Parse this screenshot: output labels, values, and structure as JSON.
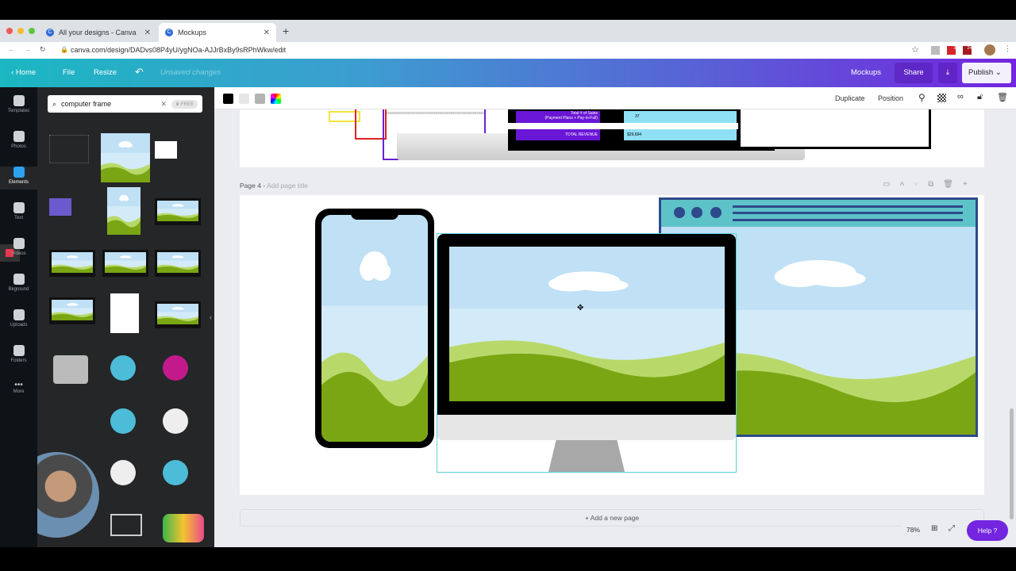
{
  "browser": {
    "tabs": [
      {
        "label": "All your designs - Canva"
      },
      {
        "label": "Mockups"
      }
    ],
    "url": "canva.com/design/DADvs08P4yU/ygNOa-AJJrBxBy9sRPhWkw/edit",
    "ext_badges": [
      "3",
      "24"
    ]
  },
  "header": {
    "home": "Home",
    "file": "File",
    "resize": "Resize",
    "status": "Unsaved changes",
    "design_name": "Mockups",
    "share": "Share",
    "publish": "Publish"
  },
  "rail": [
    {
      "label": "Templates"
    },
    {
      "label": "Photos"
    },
    {
      "label": "Elements"
    },
    {
      "label": "Text"
    },
    {
      "label": "Videos"
    },
    {
      "label": "Bkground"
    },
    {
      "label": "Uploads"
    },
    {
      "label": "Folders"
    },
    {
      "label": "More"
    }
  ],
  "panel": {
    "search_value": "computer frame",
    "free_badge": "FREE",
    "pro_badge": "$"
  },
  "toolbar": {
    "colors": [
      "#000000",
      "#e6e6e6",
      "#b3b3b3",
      "rainbow"
    ],
    "duplicate": "Duplicate",
    "position": "Position"
  },
  "page3": {
    "sales_label": "Total # of Sales",
    "sales_sub": "(Payment Plans + Pay-in-Full)",
    "sales_value": "37",
    "revenue_label": "TOTAL REVENUE",
    "revenue_value": "$29,694"
  },
  "page4": {
    "label": "Page 4",
    "title_placeholder": "Add page title"
  },
  "footer": {
    "add_page": "+ Add a new page",
    "zoom": "78%",
    "help": "Help ?"
  },
  "colors": {
    "accent": "#7325e0",
    "teal": "#1bb7c2",
    "sky": "#cfe8f7",
    "grass": "#7aa614",
    "grass_light": "#b8d96a",
    "browser_frame": "#2e4a8a",
    "browser_bar": "#5ec3c9"
  }
}
